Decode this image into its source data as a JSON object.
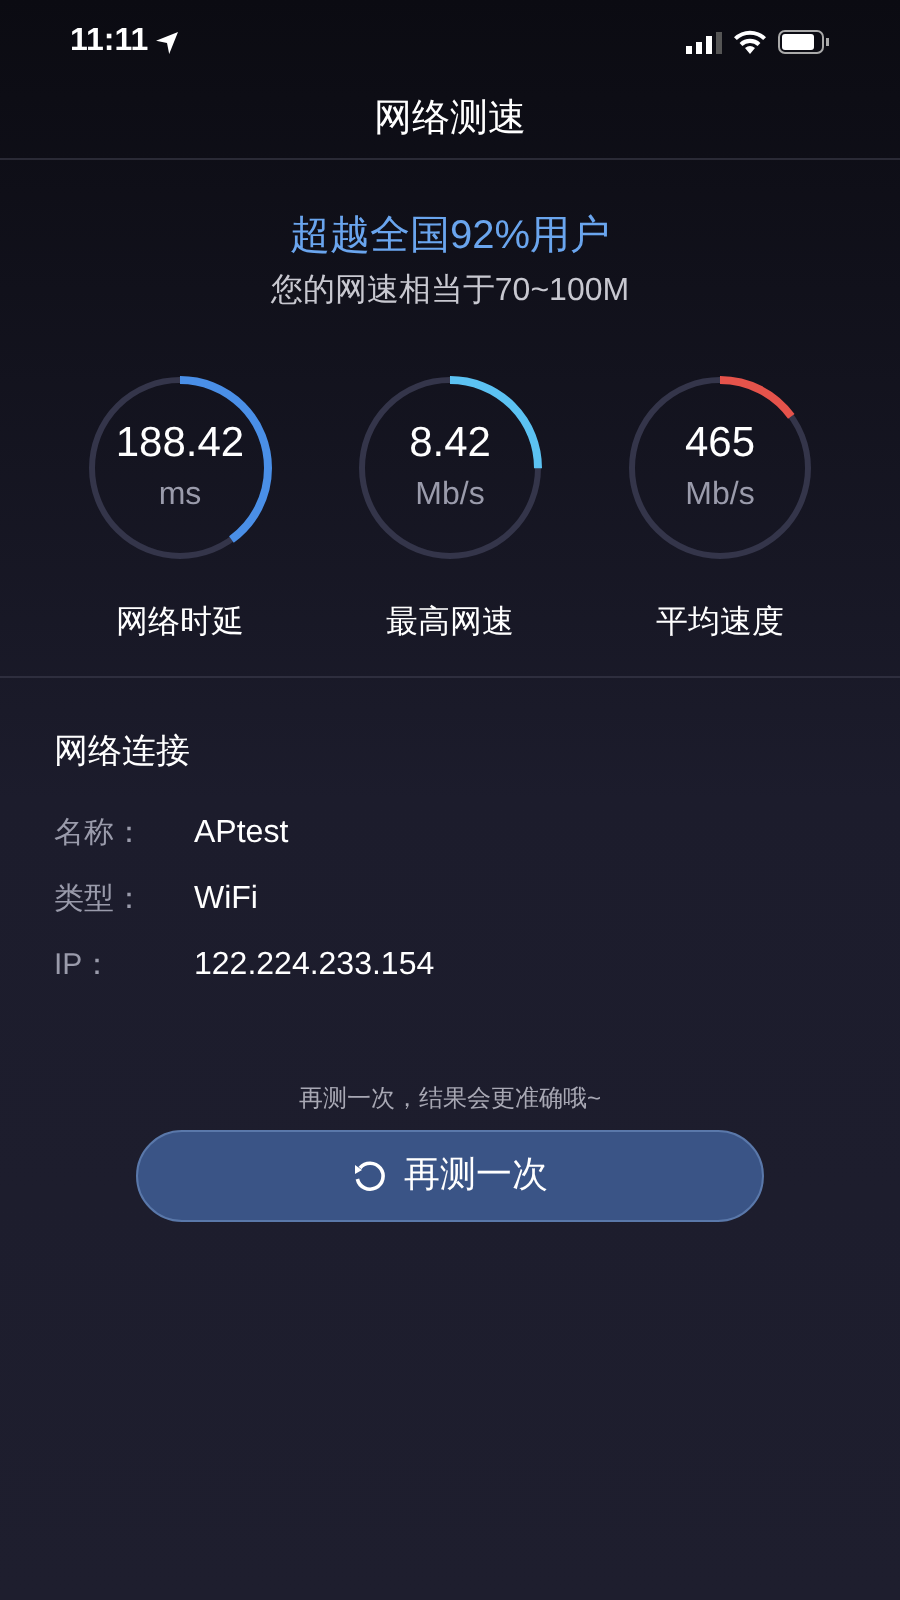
{
  "status_bar": {
    "time": "11:11"
  },
  "title": "网络测速",
  "headline": "超越全国92%用户",
  "subline": "您的网速相当于70~100M",
  "gauges": [
    {
      "value": "188.42",
      "unit": "ms",
      "label": "网络时延",
      "color": "#4a8fe7"
    },
    {
      "value": "8.42",
      "unit": "Mb/s",
      "label": "最高网速",
      "color": "#5cc2f2"
    },
    {
      "value": "465",
      "unit": "Mb/s",
      "label": "平均速度",
      "color": "#e5534b"
    }
  ],
  "connection": {
    "title": "网络连接",
    "rows": [
      {
        "label": "名称：",
        "value": "APtest"
      },
      {
        "label": "类型：",
        "value": "WiFi"
      },
      {
        "label": "IP：",
        "value": "122.224.233.154"
      }
    ]
  },
  "hint": "再测一次，结果会更准确哦~",
  "retest_button": "再测一次"
}
